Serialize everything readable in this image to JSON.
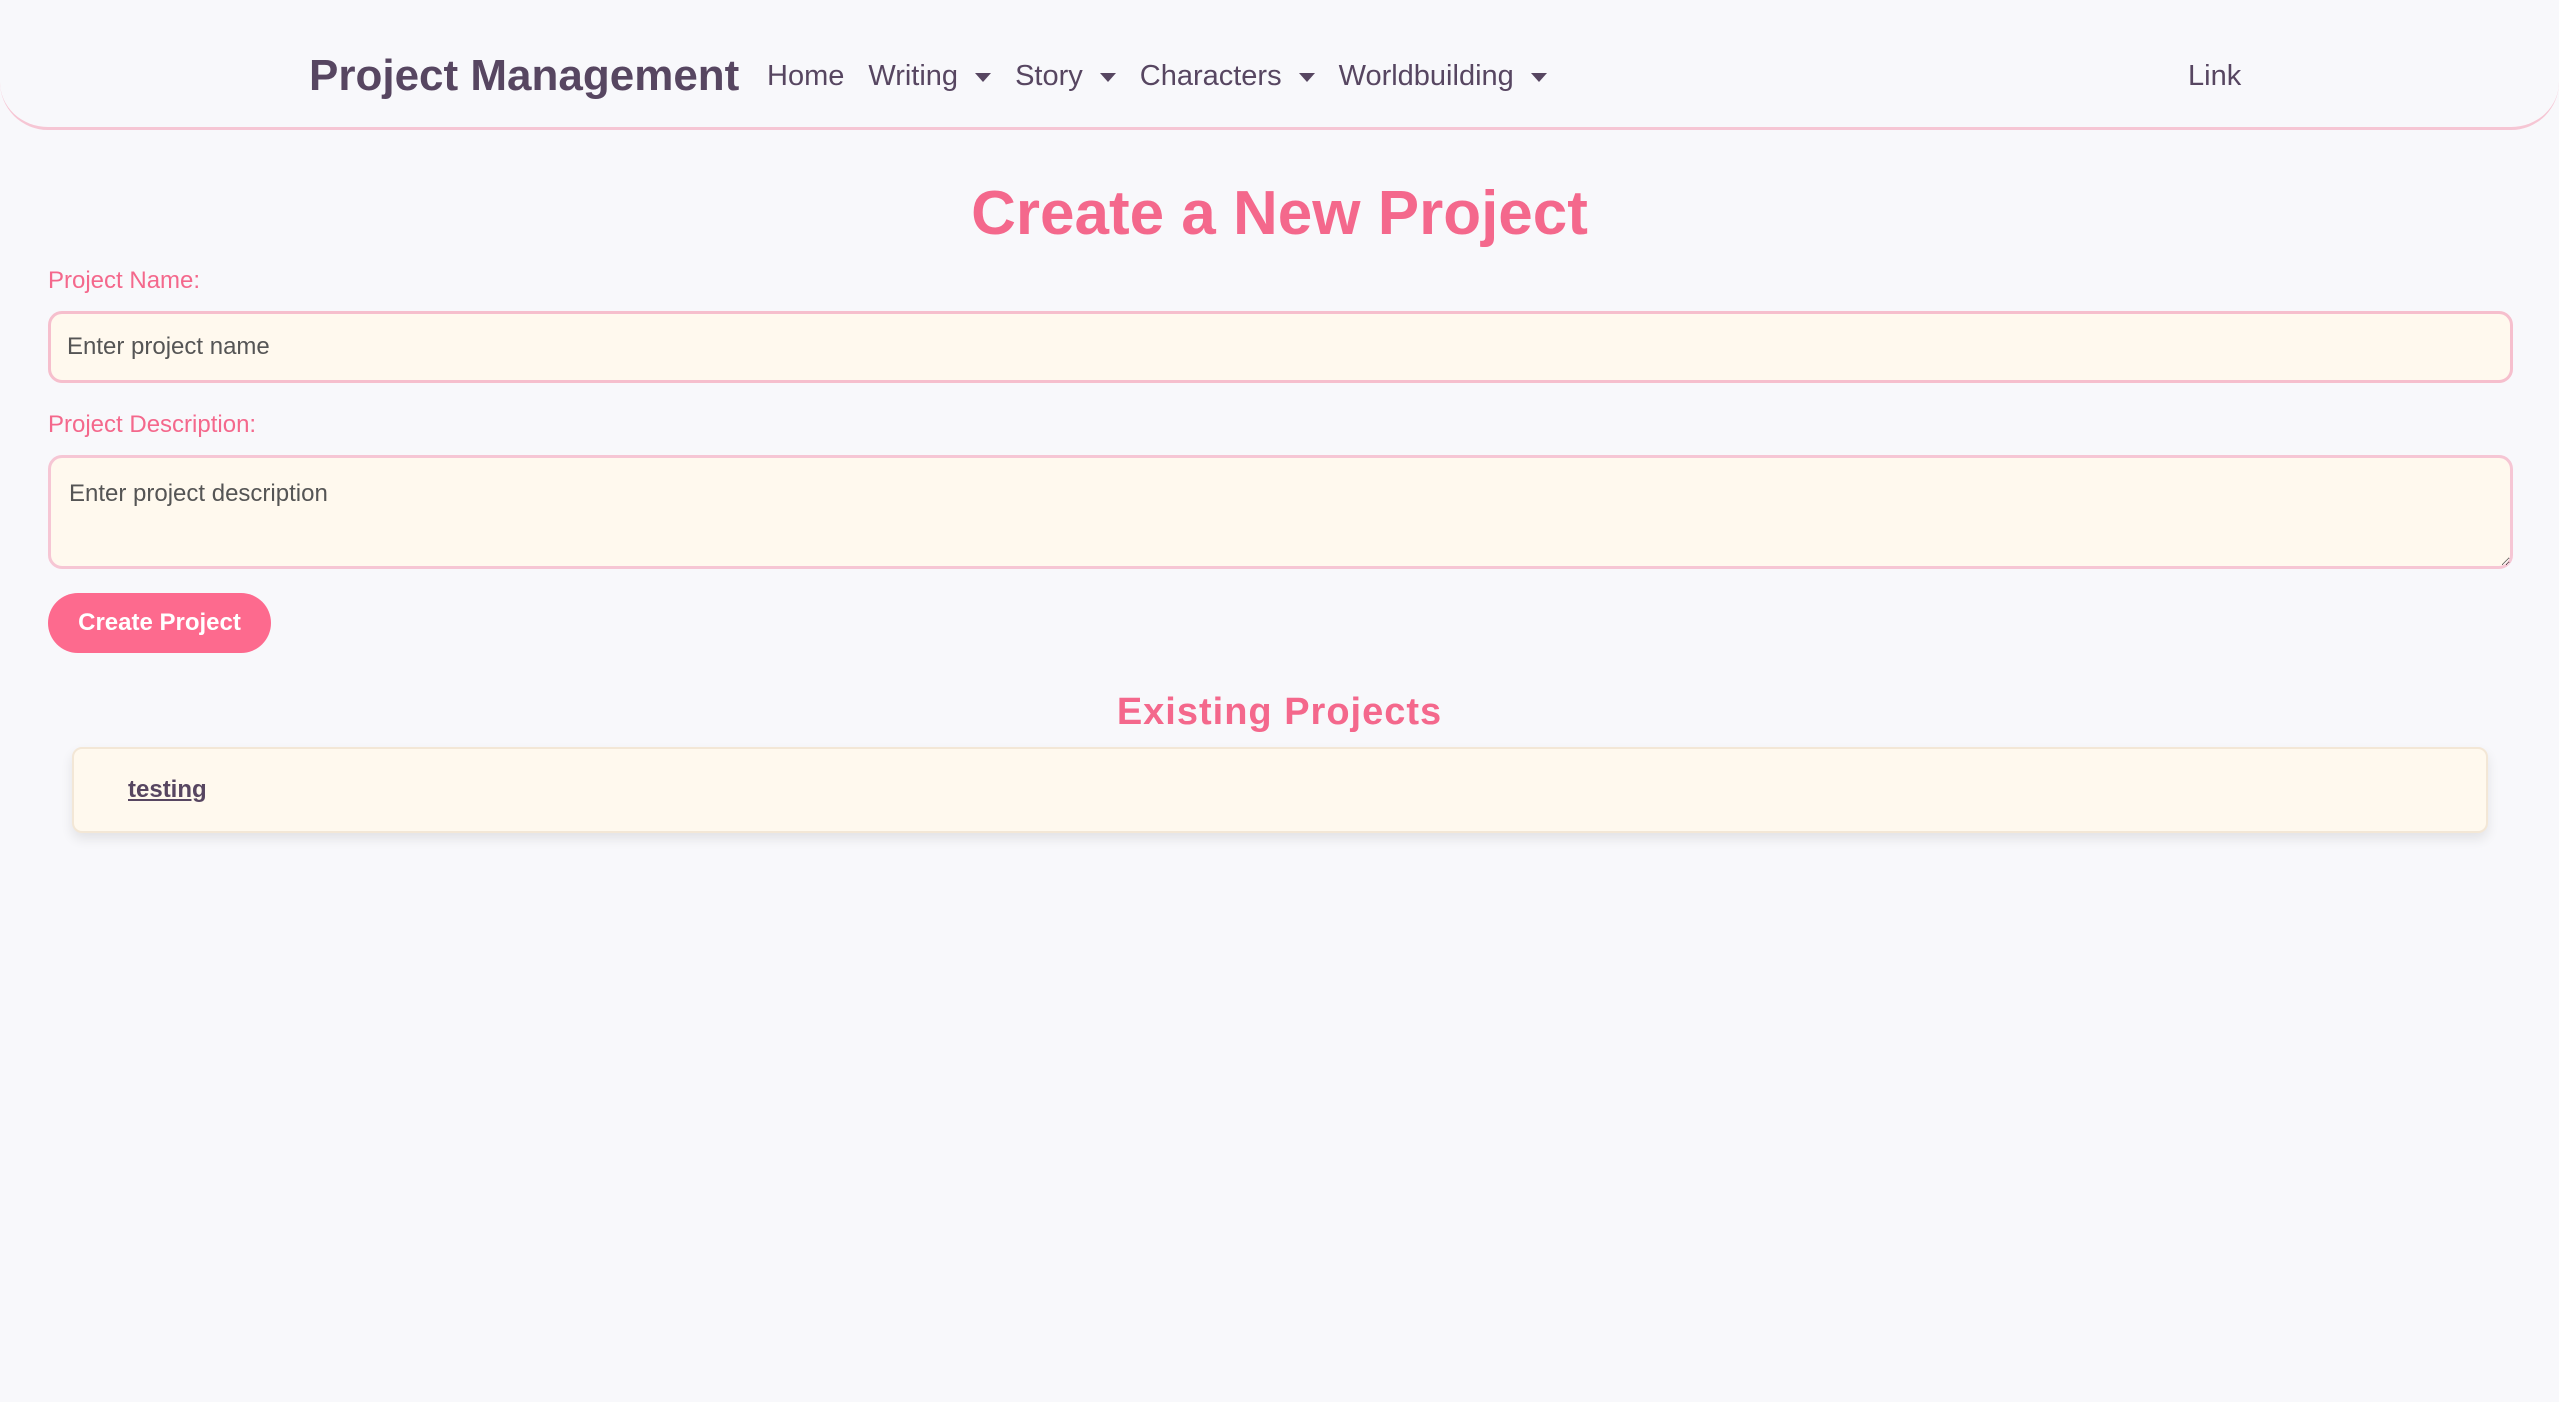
{
  "navbar": {
    "brand": "Project Management",
    "items": [
      {
        "label": "Home",
        "dropdown": false
      },
      {
        "label": "Writing",
        "dropdown": true
      },
      {
        "label": "Story",
        "dropdown": true
      },
      {
        "label": "Characters",
        "dropdown": true
      },
      {
        "label": "Worldbuilding",
        "dropdown": true
      }
    ],
    "right_link": "Link"
  },
  "form": {
    "title": "Create a New Project",
    "name_label": "Project Name:",
    "name_placeholder": "Enter project name",
    "name_value": "",
    "description_label": "Project Description:",
    "description_placeholder": "Enter project description",
    "description_value": "",
    "submit_label": "Create Project"
  },
  "existing": {
    "title": "Existing Projects",
    "projects": [
      {
        "name": "testing"
      }
    ]
  },
  "colors": {
    "accent": "#f4688c",
    "button": "#fd6a8e",
    "text_dark": "#574661",
    "input_bg": "#fff9ee",
    "border_pink": "#f6c6d4"
  }
}
